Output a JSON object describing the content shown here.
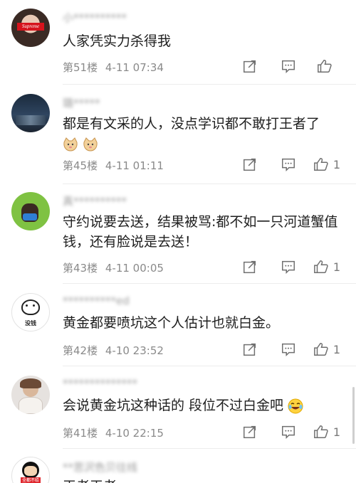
{
  "comments": [
    {
      "username": "小**********",
      "avatar_badge": "Supreme",
      "text": "人家凭实力杀得我",
      "floor": "第51楼",
      "time": "4-11 07:34",
      "likes": ""
    },
    {
      "username": "璐*****",
      "text": "都是有文采的人，没点学识都不敢打王者了",
      "floor": "第45楼",
      "time": "4-11 01:11",
      "likes": "1"
    },
    {
      "username": "真**********",
      "text": "守约说要去送，结果被骂:都不如一只河道蟹值钱，还有脸说是去送！",
      "floor": "第43楼",
      "time": "4-11 00:05",
      "likes": "1"
    },
    {
      "username": "**********ed",
      "avatar_badge": "没钱",
      "text": "黄金都要喷坑这个人估计也就白金。",
      "floor": "第42楼",
      "time": "4-10 23:52",
      "likes": "1"
    },
    {
      "username": "**************",
      "text": "会说黄金坑这种话的 段位不过白金吧",
      "floor": "第41楼",
      "time": "4-10 22:15",
      "likes": "1"
    },
    {
      "username": "**思沢色贝往线",
      "avatar_badge": "全都不给",
      "text": "王者王者",
      "floor": "",
      "time": "",
      "likes": ""
    }
  ],
  "icons": {
    "share": "share-icon",
    "reply": "comment-icon",
    "like": "thumbs-up-icon",
    "cat_emoji": "cat-emoji-icon",
    "laugh_emoji": "laughing-emoji-icon"
  },
  "colors": {
    "meta": "#8a8a8a",
    "text": "#1e1e1e",
    "divider": "#ececec"
  }
}
